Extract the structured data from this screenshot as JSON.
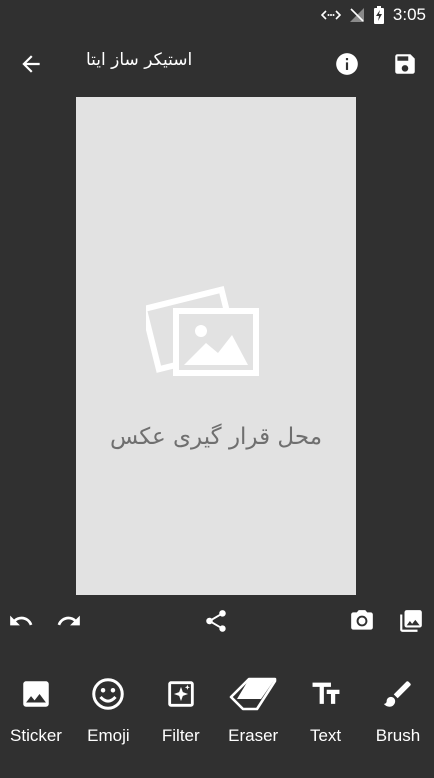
{
  "status_bar": {
    "time": "3:05"
  },
  "app_bar": {
    "title": "استیکر ساز ایتا"
  },
  "canvas": {
    "placeholder_text": "محل قرار گیری عکس",
    "background": "#e2e2e2"
  },
  "tools": [
    {
      "label": "Sticker",
      "icon": "image-icon"
    },
    {
      "label": "Emoji",
      "icon": "emoji-icon"
    },
    {
      "label": "Filter",
      "icon": "filter-icon"
    },
    {
      "label": "Eraser",
      "icon": "eraser-icon"
    },
    {
      "label": "Text",
      "icon": "text-icon"
    },
    {
      "label": "Brush",
      "icon": "brush-icon"
    }
  ],
  "colors": {
    "background": "#303030",
    "canvas": "#e2e2e2",
    "placeholder_text": "#6f6f6f"
  }
}
